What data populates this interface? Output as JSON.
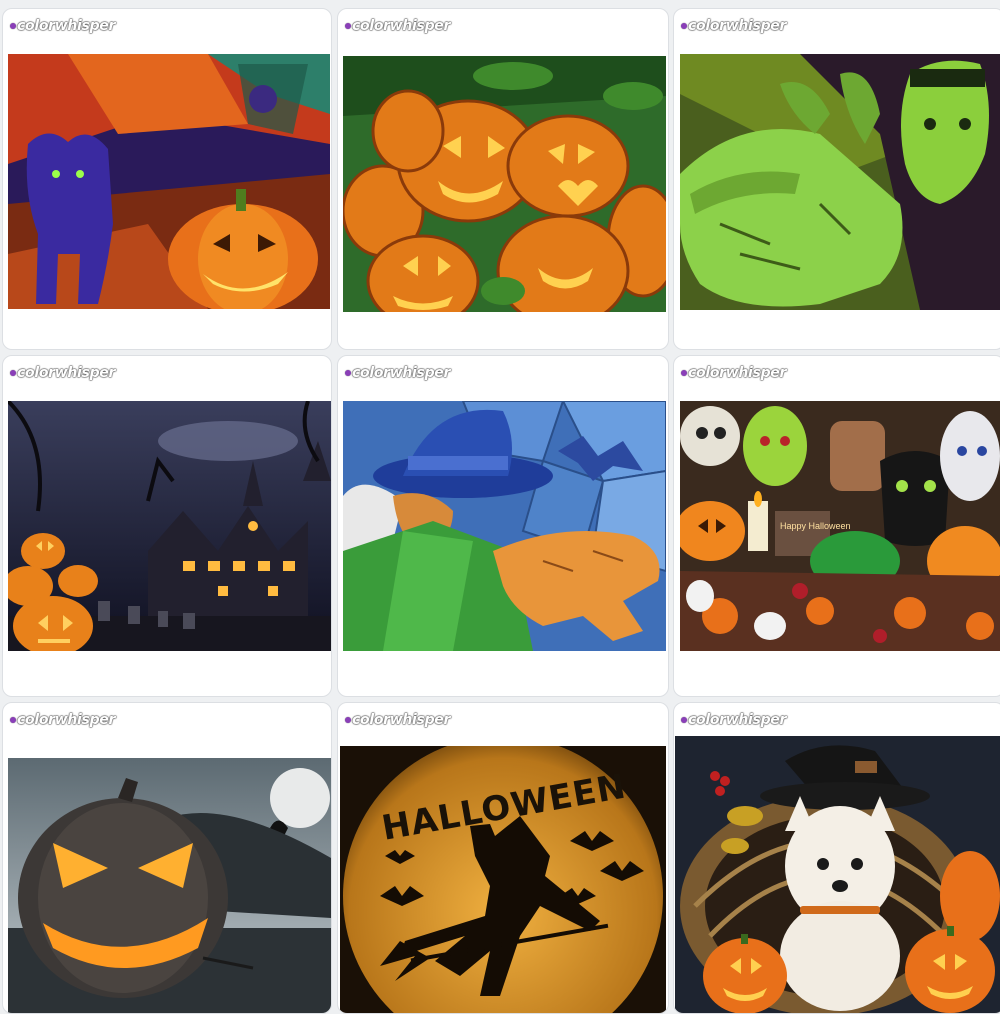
{
  "brand": {
    "logo_text": "colorwhisper"
  },
  "grid": {
    "items": [
      {
        "name": "halloween-cat-pumpkin"
      },
      {
        "name": "jack-o-lantern-patch"
      },
      {
        "name": "frankenstein-hand"
      },
      {
        "name": "haunted-mansion-night"
      },
      {
        "name": "witch-stained-glass"
      },
      {
        "name": "halloween-monster-collage",
        "sign_text": "Happy Halloween"
      },
      {
        "name": "glowing-pumpkin-moon"
      },
      {
        "name": "witch-moon-silhouette",
        "title_text": "HALLOWEEN"
      },
      {
        "name": "puppy-witch-hat"
      }
    ]
  },
  "colors": {
    "card_bg": "#ffffff",
    "page_bg": "#eef0f2",
    "logo_dot": "#8a3fb8"
  }
}
